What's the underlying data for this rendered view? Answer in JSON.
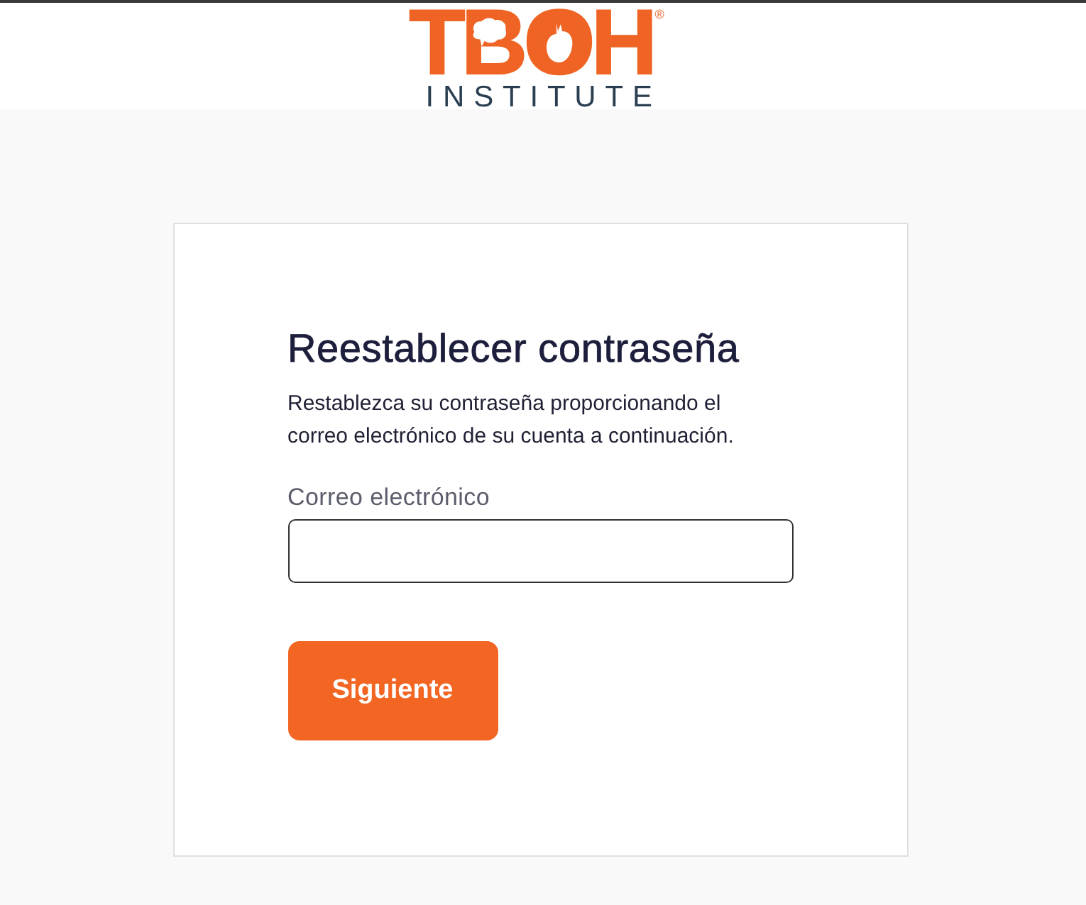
{
  "header": {
    "logo": {
      "wordmark": "TBOH",
      "registered": "®",
      "subtitle": "INSTITUTE"
    }
  },
  "form": {
    "title": "Reestablecer contraseña",
    "description": "Restablezca su contraseña proporcionando el correo electrónico de su cuenta a continuación.",
    "email_field": {
      "label": "Correo electrónico"
    },
    "submit_button": {
      "label": "Siguiente"
    }
  }
}
